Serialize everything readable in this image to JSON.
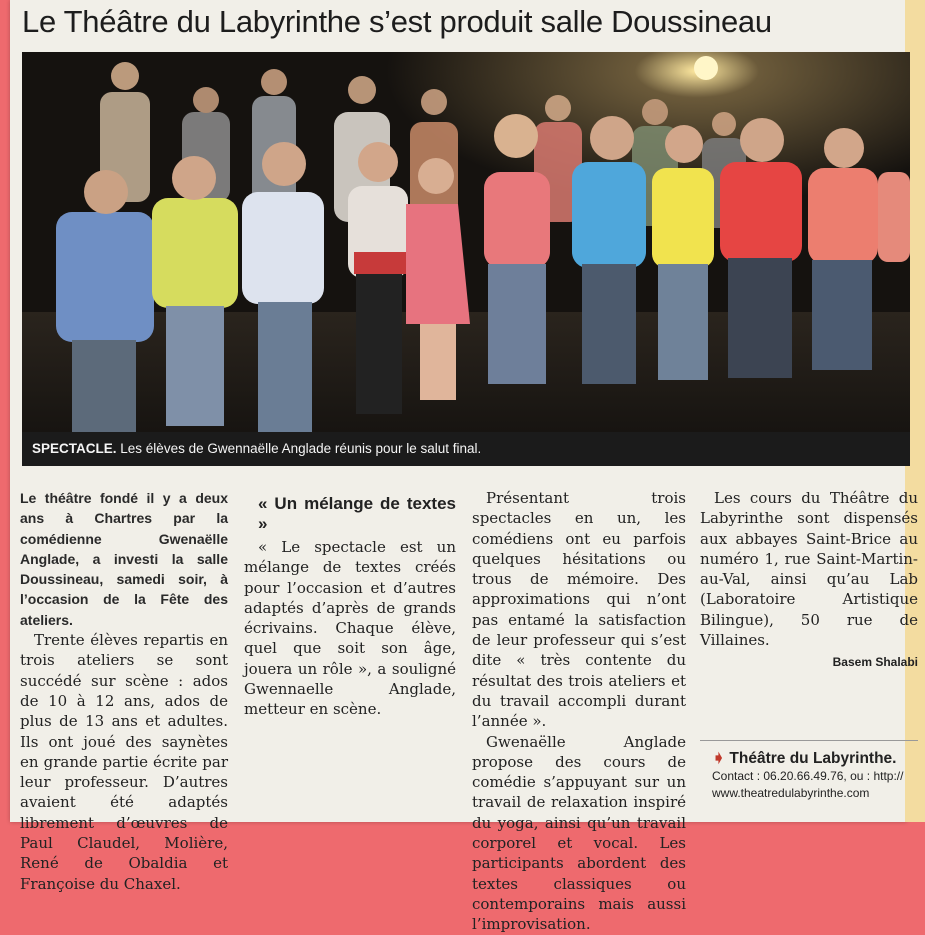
{
  "headline": "Le Théâtre du Labyrinthe s’est produit salle Doussineau",
  "photo": {
    "caption_tag": "SPECTACLE.",
    "caption_text": "Les élèves de Gwennaëlle Anglade réunis pour le salut final."
  },
  "article": {
    "lede": "Le théâtre fondé il y a deux ans à Chartres par la comédienne Gwenaëlle Anglade, a investi la salle Doussineau, samedi soir, à l’occasion de la Fête des ateliers.",
    "p1": "Trente élèves repartis en trois ateliers se sont succédé sur scène : ados de 10 à 12 ans, ados de plus de 13 ans et adultes. Ils ont joué des saynètes en grande partie écrite par leur professeur. D’autres avaient été adaptés librement d’œuvres de Paul Claudel, Molière, René de Obaldia et Françoise du Chaxel.",
    "subhead": "« Un mélange de textes »",
    "p2": "« Le spectacle est un mélange de textes créés pour l’occasion et d’autres adaptés d’après de grands écrivains. Chaque élève, quel que soit son âge, jouera un rôle », a souligné Gwennaelle Anglade, metteur en scène.",
    "p3": "Présentant trois spectacles en un, les comédiens ont eu parfois quelques hésitations ou trous de mémoire. Des approximations qui n’ont pas entamé la satisfaction de leur professeur qui s’est dite « très contente du résultat des trois ateliers et du travail accompli durant l’année ».",
    "p4": "Gwenaëlle Anglade propose des cours de comédie s’appuyant sur un travail de relaxation inspiré du yoga, ainsi qu’un travail corporel et vocal. Les participants abordent des textes classiques ou contemporains mais aussi l’improvisation.",
    "p5": "Les cours du Théâtre du Labyrinthe sont dispensés aux abbayes Saint-Brice au numéro 1, rue Saint-Martin-au-Val, ainsi qu’au Lab (Laboratoire Artistique Bilingue), 50 rue de Villaines.",
    "byline": "Basem Shalabi"
  },
  "info": {
    "title": "Théâtre du Labyrinthe.",
    "contact": "Contact : 06.20.66.49.76, ou : http://",
    "website": "www.theatredulabyrinthe.com"
  },
  "colors": {
    "background": "#ee6a6e",
    "paper": "#f1efe8",
    "caption_bar": "#1b1b1b",
    "arrow": "#c0392b"
  }
}
